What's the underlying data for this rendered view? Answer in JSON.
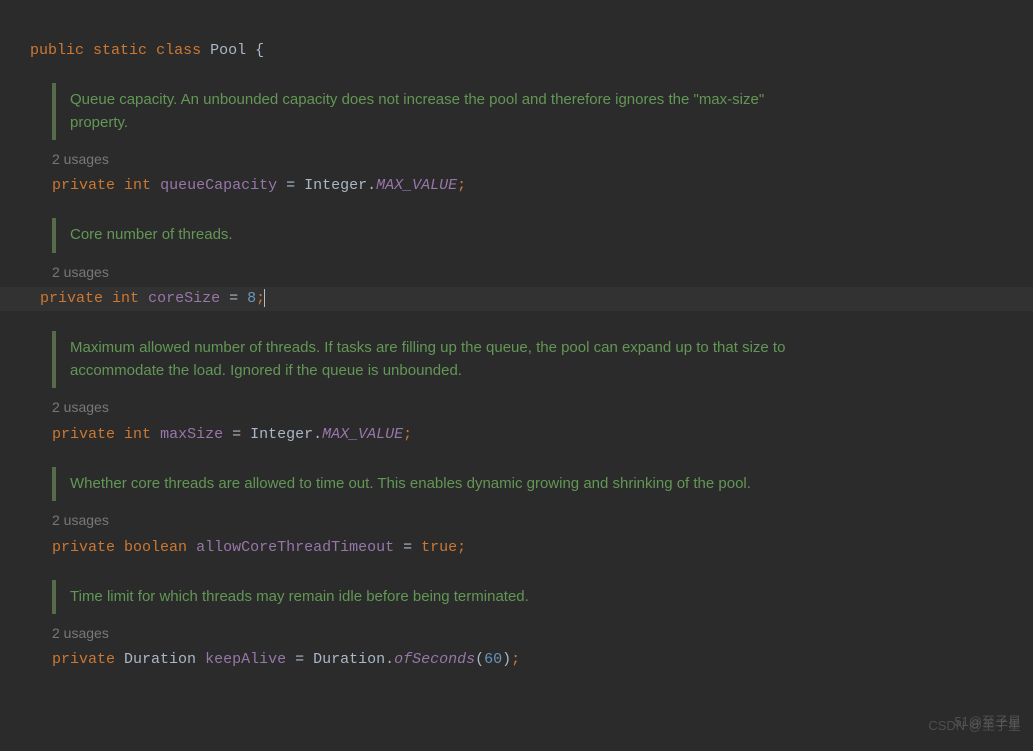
{
  "classDecl": {
    "kw_public": "public",
    "kw_static": "static",
    "kw_class": "class",
    "name": "Pool",
    "brace": "{"
  },
  "fields": [
    {
      "doc": "Queue capacity. An unbounded capacity does not increase the pool and therefore ignores the \"max-size\" property.",
      "usages": "2 usages",
      "kw_private": "private",
      "type": "int",
      "name": "queueCapacity",
      "assign": " = Integer.",
      "constant": "MAX_VALUE",
      "end": ";"
    },
    {
      "doc": "Core number of threads.",
      "usages": "2 usages",
      "kw_private": "private",
      "type": "int",
      "name": "coreSize",
      "assign": " = ",
      "number": "8",
      "end": ";",
      "highlighted": true,
      "cursor": true
    },
    {
      "doc": "Maximum allowed number of threads. If tasks are filling up the queue, the pool can expand up to that size to accommodate the load. Ignored if the queue is unbounded.",
      "usages": "2 usages",
      "kw_private": "private",
      "type": "int",
      "name": "maxSize",
      "assign": " = Integer.",
      "constant": "MAX_VALUE",
      "end": ";"
    },
    {
      "doc": "Whether core threads are allowed to time out. This enables dynamic growing and shrinking of the pool.",
      "usages": "2 usages",
      "kw_private": "private",
      "type": "boolean",
      "name": "allowCoreThreadTimeout",
      "assign": " = ",
      "bool": "true",
      "end": ";"
    },
    {
      "doc": "Time limit for which threads may remain idle before being terminated.",
      "usages": "2 usages",
      "kw_private": "private",
      "type": "Duration",
      "name": "keepAlive",
      "assign": " = Duration.",
      "method": "ofSeconds",
      "paren_open": "(",
      "number": "60",
      "paren_close": ")",
      "end": ";"
    }
  ],
  "watermarks": {
    "w1": "CSDN @至子星",
    "w2": "51@至子星"
  }
}
